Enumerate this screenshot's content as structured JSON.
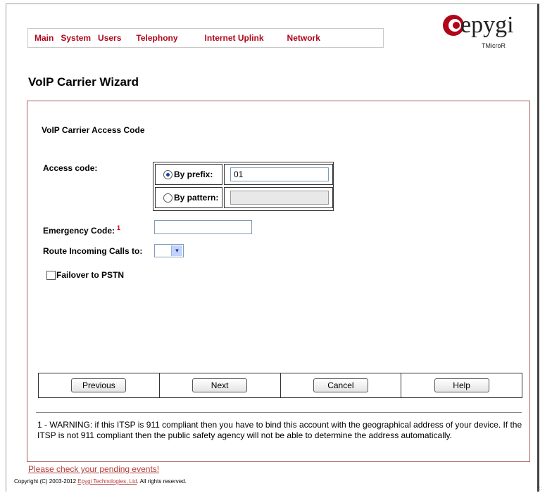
{
  "nav": {
    "items": [
      "Main",
      "System",
      "Users",
      "Telephony",
      "Internet Uplink",
      "Network"
    ]
  },
  "logo": {
    "brand": "epygi",
    "model": "TMicroR",
    "color": "#b0061a"
  },
  "page_title": "VoIP Carrier Wizard",
  "section_title": "VoIP Carrier Access Code",
  "access_code": {
    "label": "Access code:",
    "by_prefix_label": "By prefix:",
    "by_prefix_value": "01",
    "by_pattern_label": "By pattern:",
    "by_pattern_value": "",
    "selected": "by_prefix"
  },
  "emergency_code": {
    "label": "Emergency Code:",
    "footnote_mark": "1",
    "value": ""
  },
  "route_incoming": {
    "label": "Route Incoming Calls to:",
    "value": ""
  },
  "failover": {
    "label": "Failover to PSTN",
    "checked": false
  },
  "buttons": {
    "previous": "Previous",
    "next": "Next",
    "cancel": "Cancel",
    "help": "Help"
  },
  "warning": "1 - WARNING: if this ITSP is 911 compliant then you have to bind this account with the geographical address of your device. If the ITSP is not 911 compliant then the public safety agency will not be able to determine the address automatically.",
  "pending_events": "Please check your pending events!",
  "copyright": {
    "prefix": "Copyright (C) 2003-2012 ",
    "link": "Epygi Technologies, Ltd",
    "suffix": ". All rights reserved."
  }
}
